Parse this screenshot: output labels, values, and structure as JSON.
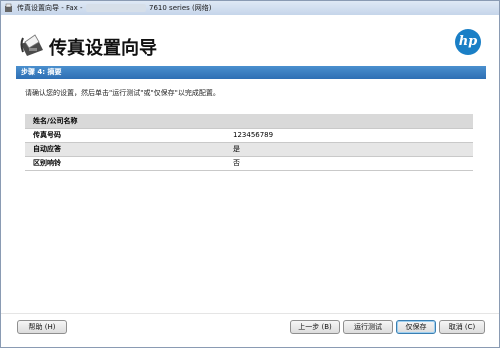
{
  "window": {
    "title_prefix": "传真设置向导 - Fax -",
    "title_suffix": "7610 series (网络)"
  },
  "header": {
    "heading": "传真设置向导"
  },
  "step": {
    "label": "步骤 4: 摘要"
  },
  "instruction": "请确认您的设置，然后单击\"运行测试\"或\"仅保存\"以完成配置。",
  "summary": {
    "header": "姓名/公司名称",
    "rows": [
      {
        "label": "传真号码",
        "value": "123456789"
      },
      {
        "label": "自动应答",
        "value": "是"
      },
      {
        "label": "区别响铃",
        "value": "否"
      }
    ]
  },
  "buttons": {
    "help": "帮助 (H)",
    "back": "上一步 (B)",
    "run_test": "运行测试",
    "save_only": "仅保存",
    "cancel": "取消 (C)"
  },
  "logo": {
    "text": "hp",
    "color": "#1a7fc6"
  }
}
